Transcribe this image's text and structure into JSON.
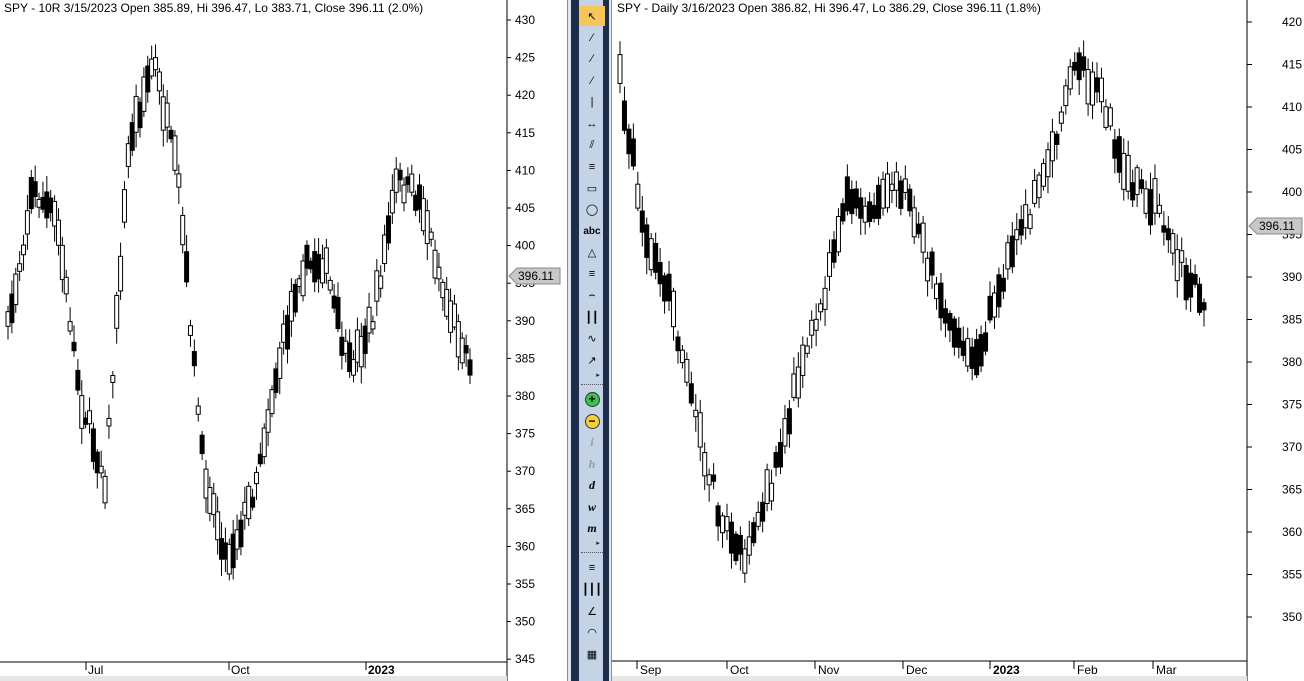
{
  "left_chart": {
    "title": "SPY - 10R 3/15/2023 Open 385.89, Hi 396.47, Lo 383.71, Close 396.11 (2.0%)",
    "price_ticks": [
      "430",
      "425",
      "420",
      "415",
      "410",
      "405",
      "400",
      "395",
      "390",
      "385",
      "380",
      "375",
      "370",
      "365",
      "360",
      "355",
      "350",
      "345"
    ],
    "time_labels": [
      {
        "text": "Jul",
        "bold": false
      },
      {
        "text": "Oct",
        "bold": false
      },
      {
        "text": "2023",
        "bold": true
      }
    ],
    "last_price_label": "396.11",
    "colors": {
      "up": "#ffffff",
      "down": "#000000",
      "label_bg": "#c8c8c8"
    }
  },
  "right_chart": {
    "title": "SPY - Daily 3/16/2023 Open 386.82, Hi 396.47, Lo 386.29, Close 396.11 (1.8%)",
    "price_ticks": [
      "420",
      "415",
      "410",
      "405",
      "400",
      "395",
      "390",
      "385",
      "380",
      "375",
      "370",
      "365",
      "360",
      "355",
      "350"
    ],
    "time_labels": [
      {
        "text": "Sep",
        "bold": false
      },
      {
        "text": "Oct",
        "bold": false
      },
      {
        "text": "Nov",
        "bold": false
      },
      {
        "text": "Dec",
        "bold": false
      },
      {
        "text": "2023",
        "bold": true
      },
      {
        "text": "Feb",
        "bold": false
      },
      {
        "text": "Mar",
        "bold": false
      }
    ],
    "last_price_label": "396.11"
  },
  "toolbar": {
    "tools": [
      {
        "name": "pointer-tool",
        "glyph": "↖",
        "active": true
      },
      {
        "name": "line-segment-tool",
        "glyph": "∕"
      },
      {
        "name": "ray-tool",
        "glyph": "∕"
      },
      {
        "name": "extended-line-tool",
        "glyph": "∕"
      },
      {
        "name": "vertical-line-tool",
        "glyph": "|"
      },
      {
        "name": "horizontal-line-tool",
        "glyph": "↔"
      },
      {
        "name": "parallel-lines-tool",
        "glyph": "⫽"
      },
      {
        "name": "channel-tool",
        "glyph": "≡"
      },
      {
        "name": "rectangle-tool",
        "glyph": "▭"
      },
      {
        "name": "ellipse-tool",
        "glyph": "◯"
      },
      {
        "name": "text-tool",
        "glyph": "abc"
      },
      {
        "name": "triangle-tool",
        "glyph": "△"
      },
      {
        "name": "fibonacci-fan-tool",
        "glyph": "≡"
      },
      {
        "name": "arc-tool",
        "glyph": "⌢"
      },
      {
        "name": "time-cycles-tool",
        "glyph": "┃┃"
      },
      {
        "name": "polyline-tool",
        "glyph": "∿"
      },
      {
        "name": "arrow-tool",
        "glyph": "↗"
      }
    ],
    "zoom_tools": [
      {
        "name": "zoom-in-icon",
        "glyph": "+"
      },
      {
        "name": "zoom-out-icon",
        "glyph": "−"
      }
    ],
    "period_tools": [
      {
        "name": "period-intraday",
        "glyph": "i"
      },
      {
        "name": "period-hourly",
        "glyph": "h"
      },
      {
        "name": "period-daily",
        "glyph": "d"
      },
      {
        "name": "period-weekly",
        "glyph": "w"
      },
      {
        "name": "period-monthly",
        "glyph": "m"
      }
    ],
    "lower_tools": [
      {
        "name": "horizontal-lines-tool",
        "glyph": "≡"
      },
      {
        "name": "vertical-lines-tool",
        "glyph": "┃┃┃"
      },
      {
        "name": "gann-fan-tool",
        "glyph": "∠"
      },
      {
        "name": "arcs-tool",
        "glyph": "◠"
      },
      {
        "name": "grid-tool",
        "glyph": "▦"
      }
    ]
  }
}
